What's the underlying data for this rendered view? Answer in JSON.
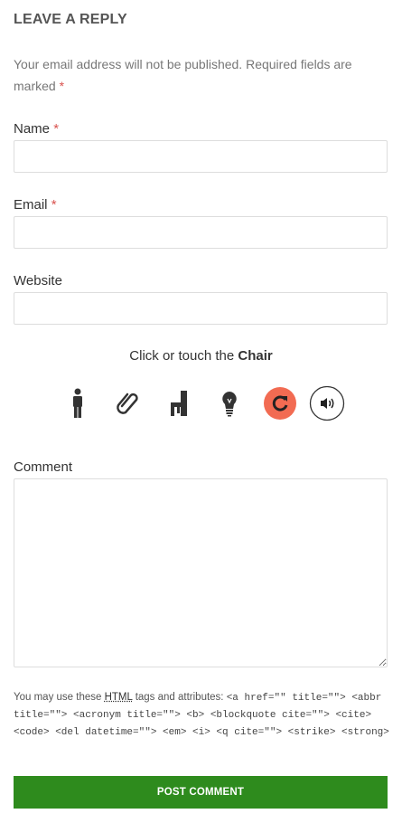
{
  "reply": {
    "title": "LEAVE A REPLY",
    "notes": "Your email address will not be published. Required fields are marked",
    "required_mark": "*"
  },
  "fields": {
    "name_label": "Name",
    "email_label": "Email",
    "website_label": "Website",
    "comment_label": "Comment",
    "name_value": "",
    "email_value": "",
    "website_value": "",
    "comment_value": ""
  },
  "captcha": {
    "prompt": "Click or touch the",
    "target": "Chair",
    "icons": [
      "person-icon",
      "paperclip-icon",
      "chair-icon",
      "lightbulb-icon",
      "refresh-icon",
      "audio-icon"
    ],
    "refresh_color": "#f26b52"
  },
  "allowed_tags": {
    "prefix": "You may use these",
    "abbr": "HTML",
    "suffix": "tags and attributes:",
    "code": "<a href=\"\" title=\"\"> <abbr title=\"\"> <acronym title=\"\"> <b> <blockquote cite=\"\"> <cite> <code> <del datetime=\"\"> <em> <i> <q cite=\"\"> <strike> <strong>"
  },
  "submit_label": "POST COMMENT",
  "colors": {
    "submit_bg": "#2e8b1d",
    "required": "#d9534f"
  }
}
